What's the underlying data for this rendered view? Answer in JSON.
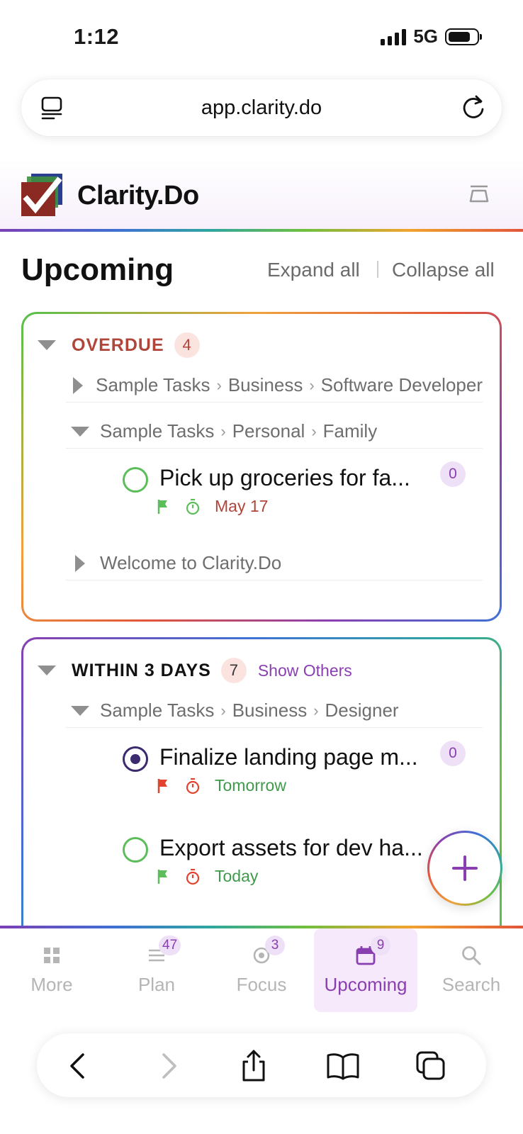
{
  "status_bar": {
    "time": "1:12",
    "network": "5G"
  },
  "browser": {
    "url": "app.clarity.do"
  },
  "app": {
    "brand": "Clarity.Do"
  },
  "page": {
    "title": "Upcoming",
    "expand_all": "Expand all",
    "collapse_all": "Collapse all"
  },
  "sections": [
    {
      "title": "OVERDUE",
      "count": "4",
      "groups": [
        {
          "path": [
            "Sample Tasks",
            "Business",
            "Software Developer"
          ],
          "expanded": false
        },
        {
          "path": [
            "Sample Tasks",
            "Personal",
            "Family"
          ],
          "expanded": true,
          "tasks": [
            {
              "title": "Pick up groceries for fa...",
              "subtasks": "0",
              "date": "May 17",
              "date_color": "#b0453a",
              "flag_color": "#5cbe5a",
              "timer_color": "#5cbe5a",
              "status": "open"
            }
          ]
        },
        {
          "path": [
            "Welcome to Clarity.Do"
          ],
          "expanded": false
        }
      ]
    },
    {
      "title": "WITHIN 3 DAYS",
      "count": "7",
      "show_others": "Show Others",
      "groups": [
        {
          "path": [
            "Sample Tasks",
            "Business",
            "Designer"
          ],
          "expanded": true,
          "tasks": [
            {
              "title": "Finalize landing page m...",
              "subtasks": "0",
              "date": "Tomorrow",
              "date_color": "#3f9a4c",
              "flag_color": "#e2432e",
              "timer_color": "#e2432e",
              "status": "in-progress"
            },
            {
              "title": "Export assets for dev ha...",
              "date": "Today",
              "date_color": "#3f9a4c",
              "flag_color": "#5cbe5a",
              "timer_color": "#e2432e",
              "status": "open"
            }
          ]
        }
      ]
    }
  ],
  "tabs": [
    {
      "label": "More",
      "icon": "grid-icon"
    },
    {
      "label": "Plan",
      "icon": "list-icon",
      "badge": "47"
    },
    {
      "label": "Focus",
      "icon": "target-icon",
      "badge": "3"
    },
    {
      "label": "Upcoming",
      "icon": "calendar-icon",
      "badge": "9",
      "active": true
    },
    {
      "label": "Search",
      "icon": "search-icon"
    }
  ],
  "colors": {
    "accent": "#8a3fb0",
    "overdue": "#b0453a",
    "done_green": "#5cbe5a"
  }
}
